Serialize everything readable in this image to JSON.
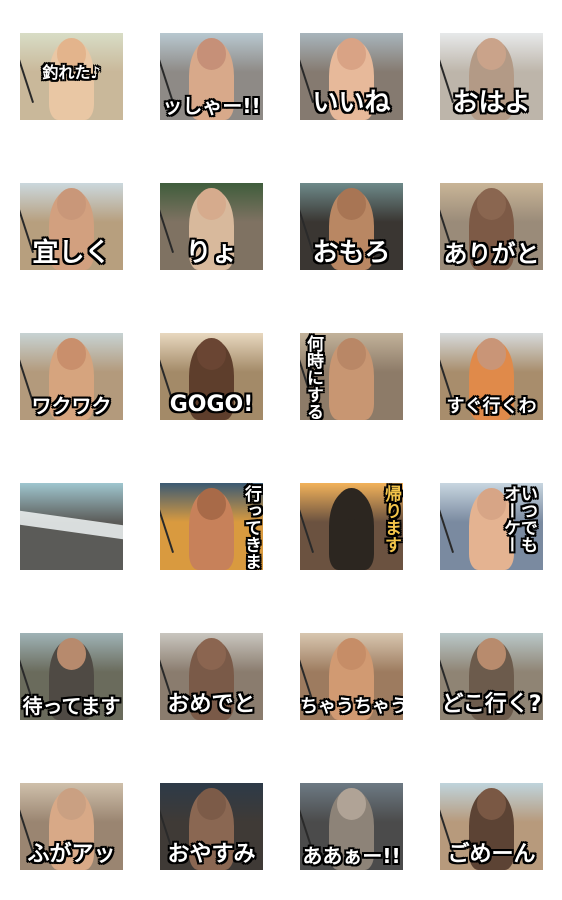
{
  "stickers": [
    {
      "caption": "釣れた♪",
      "style": "mid",
      "sky": "#d8ddc6",
      "ground": "#c9b89a",
      "figure": "#e9c7a4",
      "head": "#e3b48c"
    },
    {
      "caption": "ッしゃー!!",
      "style": "s20",
      "sky": "#b8c8d0",
      "ground": "#8e8a86",
      "figure": "#d8a98a",
      "head": "#c69078"
    },
    {
      "caption": "いいね",
      "style": "s26",
      "sky": "#a8b5bc",
      "ground": "#857a70",
      "figure": "#e7b99a",
      "head": "#d9a385"
    },
    {
      "caption": "おはよ",
      "style": "s26",
      "sky": "#e7e9ea",
      "ground": "#bdb5aa",
      "figure": "#b39a86",
      "head": "#caa38a"
    },
    {
      "caption": "宜しく",
      "style": "s26",
      "sky": "#cbd8dd",
      "ground": "#b79f7e",
      "figure": "#d2a07f",
      "head": "#c99779"
    },
    {
      "caption": "りょ",
      "style": "s26",
      "sky": "#3f5d3c",
      "ground": "#7f7262",
      "figure": "#d8b99c",
      "head": "#d6ab8d"
    },
    {
      "caption": "おもろ",
      "style": "s26",
      "sky": "#6e8a8a",
      "ground": "#3a3632",
      "figure": "#b98763",
      "head": "#a87554"
    },
    {
      "caption": "ありがと",
      "style": "s24",
      "sky": "#c9b597",
      "ground": "#9a8b79",
      "figure": "#7d5a46",
      "head": "#8a6650"
    },
    {
      "caption": "ワクワク",
      "style": "s20",
      "sky": "#c7d3d3",
      "ground": "#b39a7c",
      "figure": "#d6a47e",
      "head": "#c98f6c"
    },
    {
      "caption": "GOGO!",
      "style": "s22",
      "sky": "#e8d8bf",
      "ground": "#a38a68",
      "figure": "#5e3e2c",
      "head": "#6a4533"
    },
    {
      "caption": "何時にする?",
      "style": "vert-left",
      "sky": "#c2b29a",
      "ground": "#8d7b68",
      "figure": "#c89672",
      "head": "#b98766"
    },
    {
      "caption": "すぐ行くわ",
      "style": "s18",
      "sky": "#d6dadb",
      "ground": "#a88d6c",
      "figure": "#e08a4a",
      "head": "#c99577"
    },
    {
      "caption": "",
      "style": "s20",
      "sky": "#9fc6cf",
      "ground": "#5b5b58",
      "figure": "#9ec6cc",
      "head": "#b2d6dc"
    },
    {
      "caption": "行ってきま",
      "style": "vert",
      "sky": "#3b5a73",
      "ground": "#d99a3f",
      "figure": "#c7815a",
      "head": "#a86a48"
    },
    {
      "caption": "帰ります",
      "style": "vert gold",
      "sky": "#f2b25a",
      "ground": "#6b5240",
      "figure": "#2c2620",
      "head": "#2c2620"
    },
    {
      "caption": "いつでもオーケー",
      "style": "vert2",
      "sky": "#c8d6e0",
      "ground": "#7a8aa0",
      "figure": "#e4b391",
      "head": "#d7a586"
    },
    {
      "caption": "待ってます",
      "style": "s20",
      "sky": "#9fb3b6",
      "ground": "#6a6b5c",
      "figure": "#4f4a44",
      "head": "#b78a6d"
    },
    {
      "caption": "おめでと",
      "style": "s22",
      "sky": "#c9c6bf",
      "ground": "#8a7c6e",
      "figure": "#7a5a48",
      "head": "#8b6550"
    },
    {
      "caption": "ちゃうちゃう",
      "style": "s18",
      "sky": "#d8c7b0",
      "ground": "#9d7b5f",
      "figure": "#d19a72",
      "head": "#c68d67"
    },
    {
      "caption": "どこ行く?",
      "style": "s22",
      "sky": "#b9c8c9",
      "ground": "#8f8474",
      "figure": "#6c5b4c",
      "head": "#b88b6d"
    },
    {
      "caption": "ふがアッ",
      "style": "s22",
      "sky": "#cfc0ab",
      "ground": "#9a8571",
      "figure": "#d8a987",
      "head": "#caa082"
    },
    {
      "caption": "おやすみ",
      "style": "s22",
      "sky": "#2d3a48",
      "ground": "#3f3a36",
      "figure": "#8a6752",
      "head": "#7c5b48"
    },
    {
      "caption": "ああぁー!!",
      "style": "s20",
      "sky": "#6d7a84",
      "ground": "#4b4b4b",
      "figure": "#8d8378",
      "head": "#b0a396"
    },
    {
      "caption": "ごめーん",
      "style": "s22",
      "sky": "#bfd4dc",
      "ground": "#b79a7c",
      "figure": "#5c4334",
      "head": "#7a5844"
    }
  ]
}
